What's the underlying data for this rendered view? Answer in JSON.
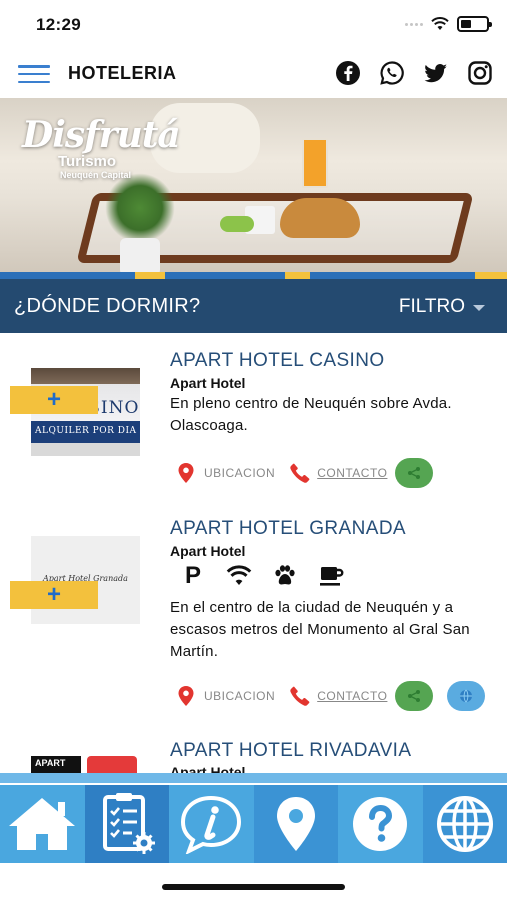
{
  "status_bar": {
    "time": "12:29"
  },
  "header": {
    "title": "HOTELERIA",
    "menu_icon": "hamburger-menu-icon",
    "social_icons": [
      "facebook-icon",
      "whatsapp-icon",
      "twitter-icon",
      "instagram-icon"
    ]
  },
  "banner": {
    "brand_main": "Disfrutá",
    "brand_sub": "Turismo",
    "brand_city": "Neuquén Capital",
    "strip_colors": [
      "#2b6fb8",
      "#f3c13d",
      "#2b6fb8",
      "#f3c13d",
      "#2b6fb8",
      "#f3c13d"
    ]
  },
  "section": {
    "title": "¿DÓNDE DORMIR?",
    "filter_label": "FILTRO"
  },
  "hotels": [
    {
      "name": "APART HOTEL CASINO",
      "type": "Apart Hotel",
      "description": "En pleno centro de Neuquén sobre Avda. Olascoaga.",
      "thumb_text": "CASINO",
      "thumb_subtext": "ALQUILER POR DIA",
      "add_label": "+",
      "location_label": "UBICACION",
      "contact_label": "CONTACTO",
      "amenities": [],
      "has_web": false
    },
    {
      "name": "APART HOTEL GRANADA",
      "type": "Apart Hotel",
      "description": "En el centro de la ciudad de Neuquén y a escasos metros del Monumento al Gral San Martín.",
      "thumb_text": "Apart Hotel Granada",
      "add_label": "+",
      "location_label": "UBICACION",
      "contact_label": "CONTACTO",
      "amenities": [
        "parking-icon",
        "wifi-icon",
        "pets-icon",
        "coffee-icon"
      ],
      "parking_letter": "P",
      "has_web": true
    },
    {
      "name": "APART HOTEL RIVADAVIA",
      "type": "Apart Hotel",
      "thumb_text": "APART"
    }
  ],
  "bottom_nav": {
    "tabs": [
      "home-icon",
      "checklist-settings-icon",
      "info-icon",
      "location-pin-icon",
      "help-icon",
      "globe-icon"
    ]
  },
  "colors": {
    "accent": "#244a70",
    "title_blue": "#264e78",
    "add_yellow": "#f3c13d",
    "share_green": "#55a552",
    "web_blue": "#5aabe0",
    "nav_blue": "#4aa7df"
  }
}
